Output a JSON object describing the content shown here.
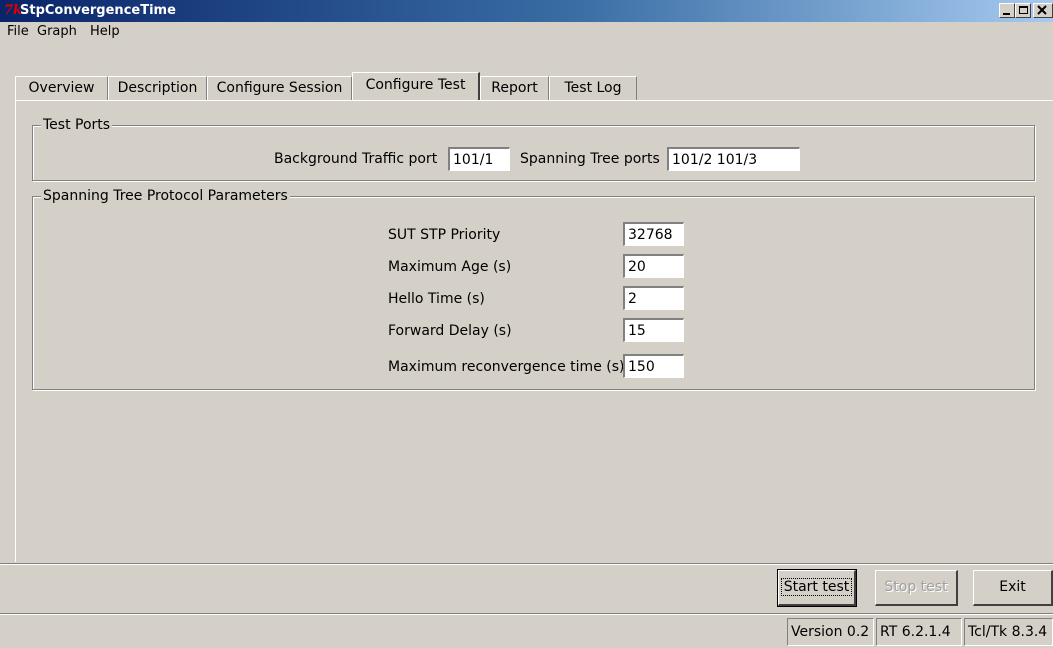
{
  "window": {
    "title": "StpConvergenceTime",
    "logo_text": "7k",
    "controls": {
      "minimize": "minimize",
      "maximize": "maximize",
      "close": "close"
    }
  },
  "menu": [
    "File",
    "Graph",
    "Help"
  ],
  "tabs": [
    {
      "label": "Overview",
      "active": false
    },
    {
      "label": "Description",
      "active": false
    },
    {
      "label": "Configure Session",
      "active": false
    },
    {
      "label": "Configure Test",
      "active": true
    },
    {
      "label": "Report",
      "active": false
    },
    {
      "label": "Test Log",
      "active": false
    }
  ],
  "test_ports": {
    "legend": "Test Ports",
    "background_label": "Background Traffic port",
    "background_value": "101/1",
    "spanning_label": "Spanning Tree ports",
    "spanning_value": "101/2 101/3"
  },
  "stp_params": {
    "legend": "Spanning Tree Protocol Parameters",
    "fields": [
      {
        "label": "SUT STP Priority",
        "value": "32768"
      },
      {
        "label": "Maximum Age (s)",
        "value": "20"
      },
      {
        "label": "Hello Time (s)",
        "value": "2"
      },
      {
        "label": "Forward Delay (s)",
        "value": "15"
      },
      {
        "label": "Maximum reconvergence time (s)",
        "value": "150"
      }
    ]
  },
  "buttons": {
    "start": "Start test",
    "stop": "Stop test",
    "exit": "Exit"
  },
  "status": {
    "version": "Version 0.2",
    "rt": "RT 6.2.1.4",
    "tcl": "Tcl/Tk 8.3.4"
  }
}
